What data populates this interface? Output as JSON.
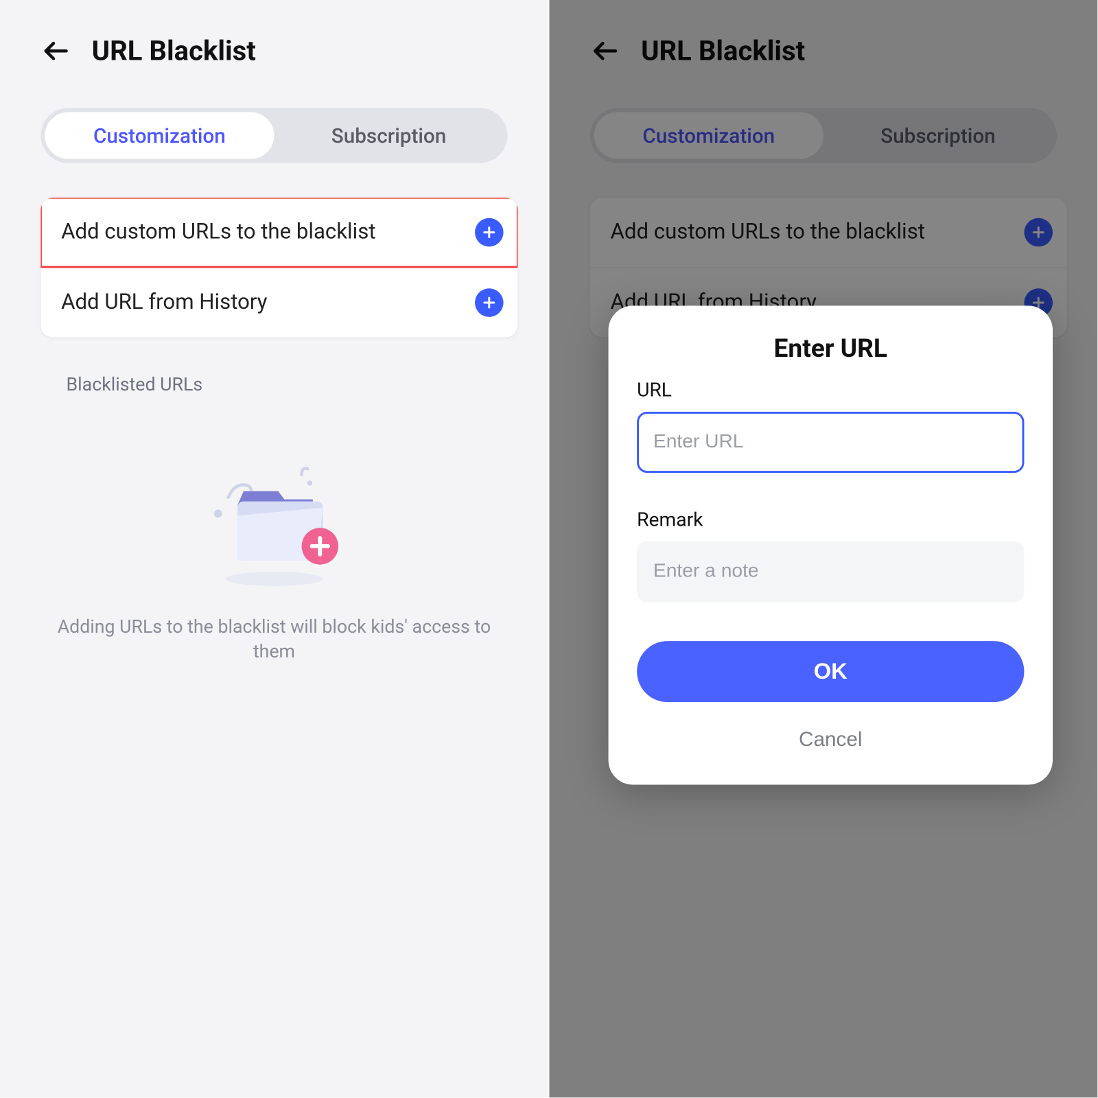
{
  "colors": {
    "accent": "#4a62ff",
    "highlightBorder": "#ef3b3b",
    "muted": "#8a8d99"
  },
  "left": {
    "title": "URL Blacklist",
    "tabs": {
      "customization": "Customization",
      "subscription": "Subscription",
      "active": "customization"
    },
    "rows": {
      "addCustom": "Add custom URLs to the blacklist",
      "addHistory": "Add URL from History"
    },
    "sectionLabel": "Blacklisted URLs",
    "emptyText": "Adding URLs to the blacklist will block kids' access to them"
  },
  "right": {
    "title": "URL Blacklist",
    "tabs": {
      "customization": "Customization",
      "subscription": "Subscription",
      "active": "customization"
    },
    "rows": {
      "addCustom": "Add custom URLs to the blacklist",
      "addHistory": "Add URL from History"
    }
  },
  "modal": {
    "title": "Enter URL",
    "urlLabel": "URL",
    "urlPlaceholder": "Enter URL",
    "remarkLabel": "Remark",
    "remarkPlaceholder": "Enter a note",
    "ok": "OK",
    "cancel": "Cancel"
  }
}
